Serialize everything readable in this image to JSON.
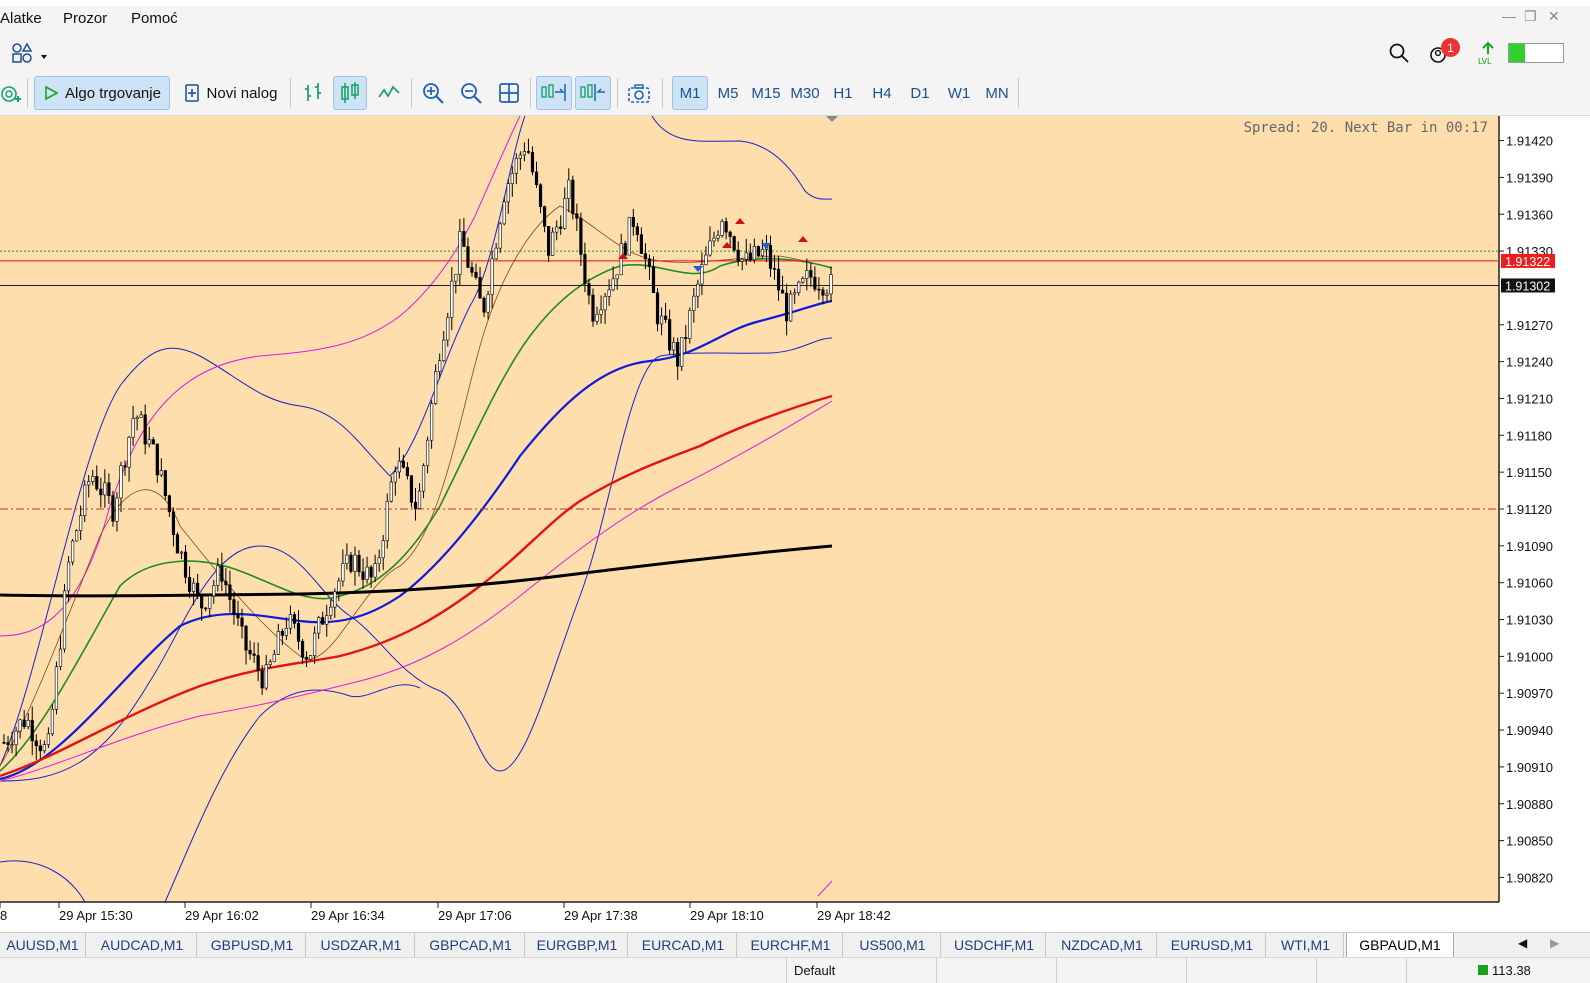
{
  "menu": {
    "items": [
      "Alatke",
      "Prozor",
      "Pomoć"
    ]
  },
  "toolbar": {
    "algo_label": "Algo trgovanje",
    "new_order_label": "Novi nalog",
    "timeframes": [
      "M1",
      "M5",
      "M15",
      "M30",
      "H1",
      "H4",
      "D1",
      "W1",
      "MN"
    ],
    "active_timeframe": "M1",
    "notification_count": "1"
  },
  "chart": {
    "spread_text": "Spread: 20. Next Bar in 00:17",
    "background_color": "#ffdead",
    "price_axis_labels": [
      "1.91420",
      "1.91390",
      "1.91360",
      "1.91330",
      "1.91270",
      "1.91240",
      "1.91210",
      "1.91180",
      "1.91150",
      "1.91120",
      "1.91090",
      "1.91060",
      "1.91030",
      "1.91000",
      "1.90970",
      "1.90940",
      "1.90910",
      "1.90880",
      "1.90850",
      "1.90820"
    ],
    "bid_price": "1.91302",
    "ask_price": "1.91322",
    "time_labels": [
      "8",
      "29 Apr 15:30",
      "29 Apr 16:02",
      "29 Apr 16:34",
      "29 Apr 17:06",
      "29 Apr 17:38",
      "29 Apr 18:10",
      "29 Apr 18:42"
    ]
  },
  "tabs": [
    "AUUSD,M1",
    "AUDCAD,M1",
    "GBPUSD,M1",
    "USDZAR,M1",
    "GBPCAD,M1",
    "EURGBP,M1",
    "EURCAD,M1",
    "EURCHF,M1",
    "US500,M1",
    "USDCHF,M1",
    "NZDCAD,M1",
    "EURUSD,M1",
    "WTI,M1",
    "GBPAUD,M1"
  ],
  "active_tab": "GBPAUD,M1",
  "status": {
    "profile": "Default",
    "right_value": "113.38"
  },
  "chart_data": {
    "type": "candlestick",
    "symbol": "GBPAUD,M1",
    "ylim": [
      1.908,
      1.9144
    ],
    "yticks": [
      1.9142,
      1.9139,
      1.9136,
      1.9133,
      1.9127,
      1.9124,
      1.9121,
      1.9118,
      1.9115,
      1.9112,
      1.9109,
      1.9106,
      1.9103,
      1.91,
      1.9097,
      1.9094,
      1.9091,
      1.9088,
      1.9085,
      1.9082
    ],
    "x_time_labels": [
      "29 Apr 15:30",
      "29 Apr 16:02",
      "29 Apr 16:34",
      "29 Apr 17:06",
      "29 Apr 17:38",
      "29 Apr 18:10",
      "29 Apr 18:42"
    ],
    "bid": 1.91302,
    "ask": 1.91322,
    "close_path": [
      1.9093,
      1.9095,
      1.9092,
      1.9108,
      1.9115,
      1.9112,
      1.912,
      1.9116,
      1.9109,
      1.9104,
      1.9107,
      1.9101,
      1.9098,
      1.9103,
      1.91,
      1.9105,
      1.9108,
      1.9106,
      1.9116,
      1.9112,
      1.9125,
      1.9134,
      1.9128,
      1.9138,
      1.9142,
      1.9133,
      1.9138,
      1.9128,
      1.9131,
      1.9136,
      1.9128,
      1.9124,
      1.9131,
      1.9136,
      1.9132,
      1.9133,
      1.9128,
      1.9131,
      1.91302
    ],
    "levels": {
      "dash_dot_red": 1.9112,
      "dotted_green": 1.9133
    }
  }
}
